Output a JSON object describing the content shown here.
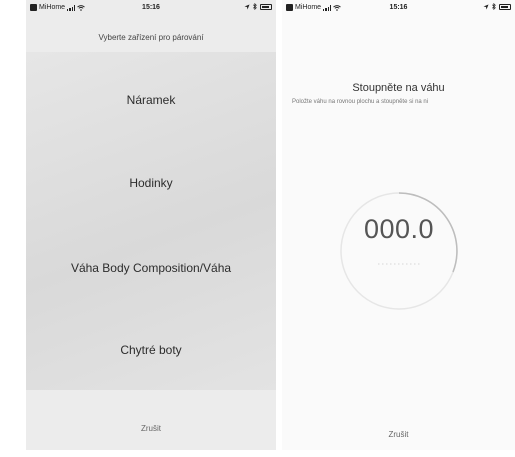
{
  "left_screen": {
    "status_bar": {
      "carrier": "MiHome",
      "time": "15:16"
    },
    "title": "Vyberte zařízení pro párování",
    "devices": [
      {
        "label": "Náramek"
      },
      {
        "label": "Hodinky"
      },
      {
        "label": "Váha Body Composition/Váha"
      },
      {
        "label": "Chytré boty"
      }
    ],
    "cancel_label": "Zrušit"
  },
  "right_screen": {
    "status_bar": {
      "carrier": "MiHome",
      "time": "15:16"
    },
    "title": "Stoupněte na váhu",
    "subtitle": "Položte váhu na rovnou plochu a stoupněte si na ni",
    "weight_value": "000.0",
    "cancel_label": "Zrušit"
  },
  "icons": [
    "mihome-app-icon",
    "signal-icon",
    "wifi-icon",
    "location-icon",
    "bluetooth-icon",
    "battery-icon"
  ]
}
